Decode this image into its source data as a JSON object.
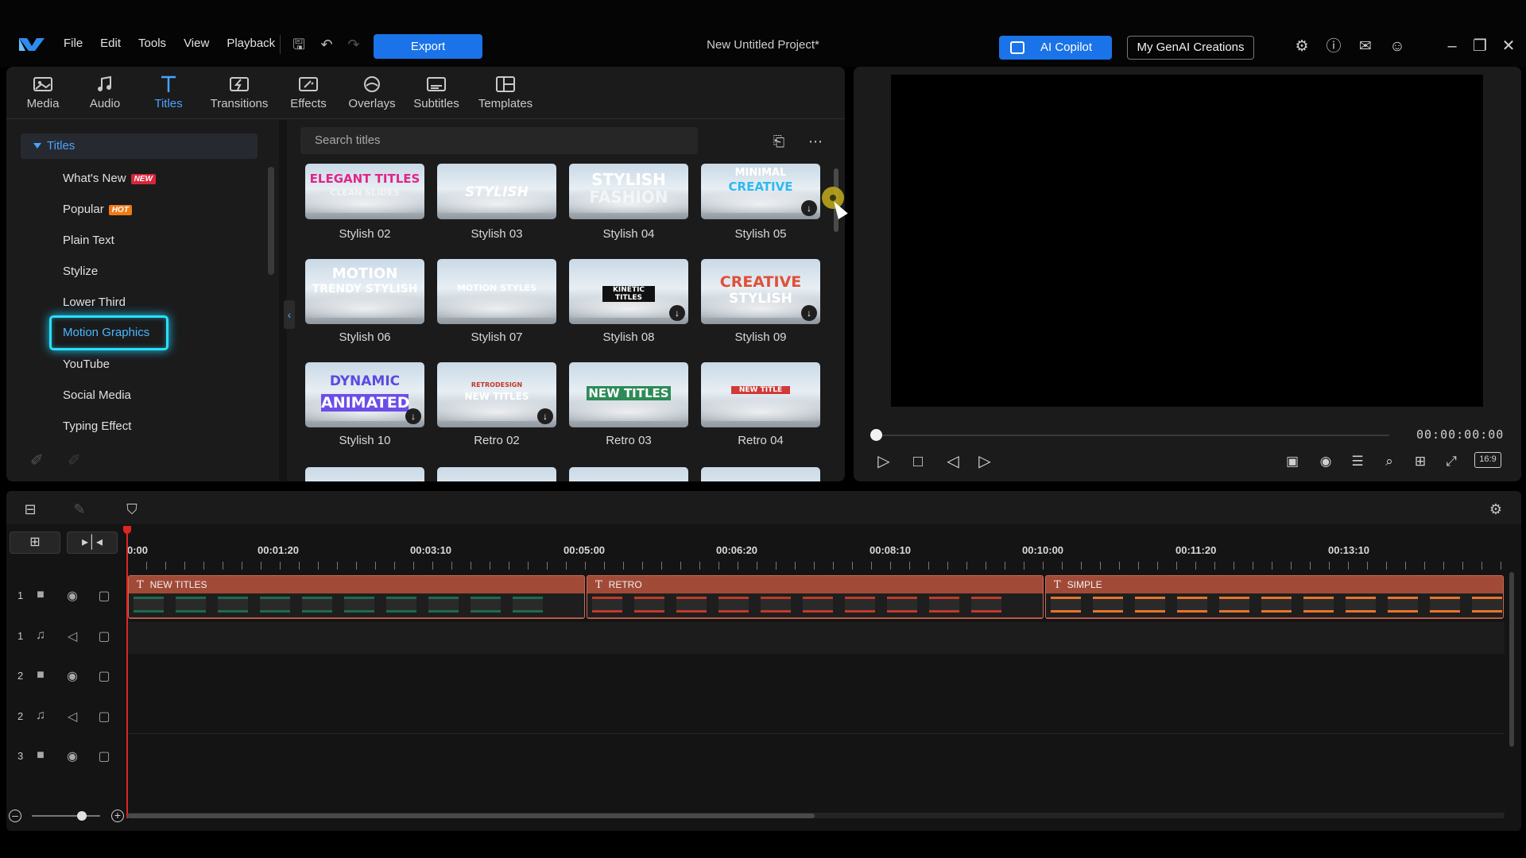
{
  "menu": [
    "File",
    "Edit",
    "Tools",
    "View",
    "Playback"
  ],
  "toolbar": {
    "export_label": "Export"
  },
  "project_title": "New Untitled Project*",
  "header_right": {
    "copilot_label": "AI Copilot",
    "genai_label": "My GenAI Creations"
  },
  "tabs": [
    {
      "label": "Media",
      "icon": "media-icon"
    },
    {
      "label": "Audio",
      "icon": "music-note-icon"
    },
    {
      "label": "Titles",
      "icon": "title-t-icon",
      "active": true
    },
    {
      "label": "Transitions",
      "icon": "transitions-icon"
    },
    {
      "label": "Effects",
      "icon": "effects-icon"
    },
    {
      "label": "Overlays",
      "icon": "overlays-icon"
    },
    {
      "label": "Subtitles",
      "icon": "subtitles-icon"
    },
    {
      "label": "Templates",
      "icon": "templates-icon"
    }
  ],
  "sidebar": {
    "header": "Titles",
    "items": [
      {
        "label": "What's New",
        "badge": "NEW"
      },
      {
        "label": "Popular",
        "badge": "HOT"
      },
      {
        "label": "Plain Text"
      },
      {
        "label": "Stylize"
      },
      {
        "label": "Lower Third"
      },
      {
        "label": "Motion Graphics",
        "selected": true
      },
      {
        "label": "YouTube"
      },
      {
        "label": "Social Media"
      },
      {
        "label": "Typing Effect"
      }
    ]
  },
  "search": {
    "placeholder": "Search titles"
  },
  "templates": [
    {
      "caption": "Stylish 02",
      "text": "ELEGANT TITLES",
      "sub": "CLEAN SLIDES",
      "download": false
    },
    {
      "caption": "Stylish 03",
      "text": "STYLISH",
      "download": false
    },
    {
      "caption": "Stylish 04",
      "text": "STYLISH",
      "sub": "FASHION",
      "download": false
    },
    {
      "caption": "Stylish 05",
      "text": "MINIMAL",
      "sub": "CREATIVE",
      "download": true
    },
    {
      "caption": "Stylish 06",
      "text": "MOTION",
      "sub": "TRENDY STYLISH",
      "download": false
    },
    {
      "caption": "Stylish 07",
      "text": "MOTION STYLES",
      "download": false
    },
    {
      "caption": "Stylish 08",
      "text": "KINETIC TITLES",
      "download": true
    },
    {
      "caption": "Stylish 09",
      "text": "CREATIVE",
      "sub": "STYLISH",
      "download": true
    },
    {
      "caption": "Stylish 10",
      "text": "DYNAMIC",
      "sub": "ANIMATED",
      "download": true
    },
    {
      "caption": "Retro 02",
      "text": "RETRODESIGN",
      "sub": "NEW TITLES",
      "download": true
    },
    {
      "caption": "Retro 03",
      "text": "NEW TITLES",
      "download": false
    },
    {
      "caption": "Retro 04",
      "text": "NEW TITLE",
      "download": false
    }
  ],
  "preview": {
    "timecode": "00:00:00:00",
    "aspect_ratio": "16:9",
    "seek_progress": 0
  },
  "timeline": {
    "ruler": [
      "0:00",
      "00:01:20",
      "00:03:10",
      "00:05:00",
      "00:06:20",
      "00:08:10",
      "00:10:00",
      "00:11:20",
      "00:13:10"
    ],
    "tracks": [
      {
        "num": "1",
        "type": "video"
      },
      {
        "num": "1",
        "type": "audio"
      },
      {
        "num": "2",
        "type": "video"
      },
      {
        "num": "2",
        "type": "audio"
      },
      {
        "num": "3",
        "type": "video"
      },
      {
        "num": "3",
        "type": "audio"
      }
    ],
    "clips": [
      {
        "label": "NEW TITLES",
        "frame_text": "NEW TITLES",
        "color": "#1f6b4a"
      },
      {
        "label": "RETRO",
        "frame_text": "RETRO",
        "color": "#c0392b"
      },
      {
        "label": "SIMPLE",
        "frame_text": "SIMPLE",
        "color": "#e8742a"
      }
    ],
    "zoom_level": 0.7
  },
  "colors": {
    "accent": "#1a73e8",
    "active_tab": "#4aa3ff",
    "clip": "#a14a37",
    "highlight": "#28e0ff",
    "playhead": "#e0251f"
  }
}
